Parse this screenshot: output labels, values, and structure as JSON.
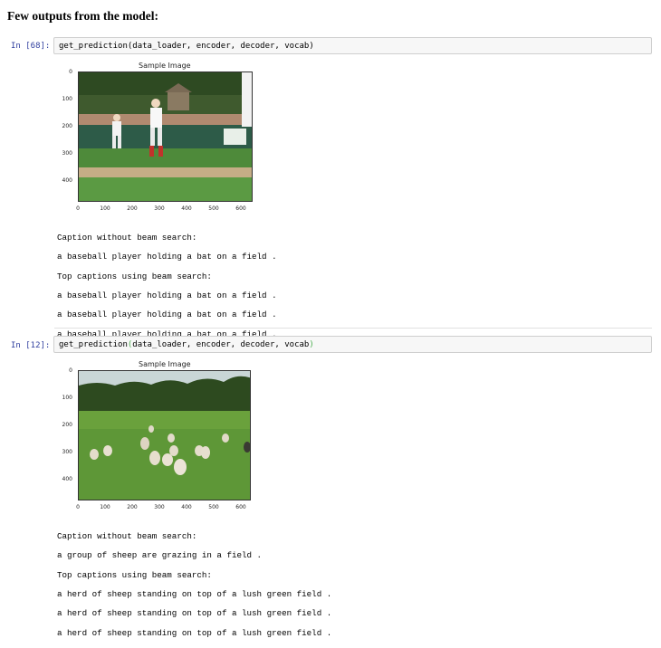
{
  "heading": "Few outputs from the model:",
  "cells": [
    {
      "prompt": "In [68]:",
      "code": "get_prediction(data_loader, encoder, decoder, vocab)",
      "figure": {
        "title": "Sample Image",
        "yticks": [
          "0",
          "100",
          "200",
          "300",
          "400"
        ],
        "xticks": [
          "0",
          "100",
          "200",
          "300",
          "400",
          "500",
          "600"
        ],
        "image_icon": "baseball-photo"
      },
      "output": [
        "Caption without beam search:",
        "a baseball player holding a bat on a field .",
        "Top captions using beam search:",
        "a baseball player holding a bat on a field .",
        "a baseball player holding a bat on a field .",
        "a baseball player holding a bat on a field ."
      ]
    },
    {
      "prompt": "In [12]:",
      "code_prefix": "get_prediction",
      "code_paren_open": "(",
      "code_args": "data_loader, encoder, decoder, vocab",
      "code_paren_close": ")",
      "figure": {
        "title": "Sample Image",
        "yticks": [
          "0",
          "100",
          "200",
          "300",
          "400"
        ],
        "xticks": [
          "0",
          "100",
          "200",
          "300",
          "400",
          "500",
          "600"
        ],
        "image_icon": "sheep-photo"
      },
      "output": [
        "Caption without beam search:",
        "a group of sheep are grazing in a field .",
        "Top captions using beam search:",
        "a herd of sheep standing on top of a lush green field .",
        "a herd of sheep standing on top of a lush green field .",
        "a herd of sheep standing on top of a lush green field ."
      ]
    }
  ]
}
